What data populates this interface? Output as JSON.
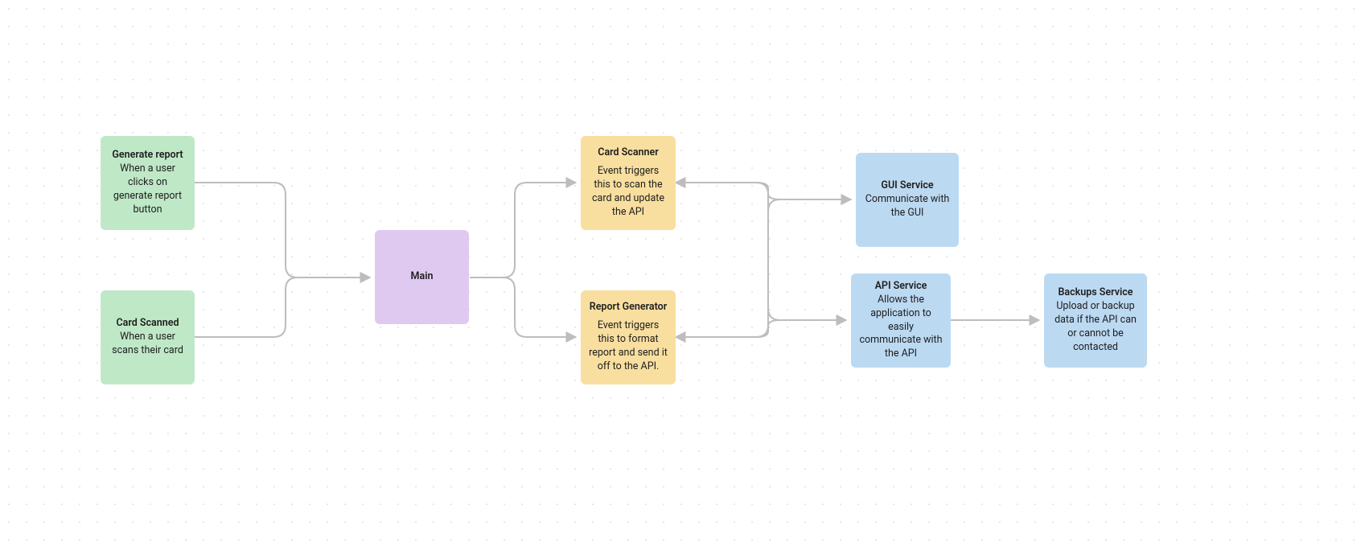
{
  "nodes": {
    "generate_report": {
      "title": "Generate report",
      "body": "When a user clicks on generate report button"
    },
    "card_scanned": {
      "title": "Card Scanned",
      "body": "When a user scans their card"
    },
    "main": {
      "title": "Main"
    },
    "card_scanner": {
      "title": "Card Scanner",
      "body": "Event triggers this to scan the card and update the API"
    },
    "report_generator": {
      "title": "Report Generator",
      "body": "Event triggers this to format report and send it off to the API."
    },
    "gui_service": {
      "title": "GUI Service",
      "body": "Communicate with the GUI"
    },
    "api_service": {
      "title": "API Service",
      "body": "Allows the application to easily communicate with the API"
    },
    "backups_service": {
      "title": "Backups Service",
      "body": "Upload or backup data if the API can or cannot be contacted"
    }
  },
  "colors": {
    "green": "#bfe8c7",
    "purple": "#dfc9f1",
    "yellow": "#f9df9f",
    "blue": "#bcd9f2",
    "edge": "#bdbdbd"
  }
}
